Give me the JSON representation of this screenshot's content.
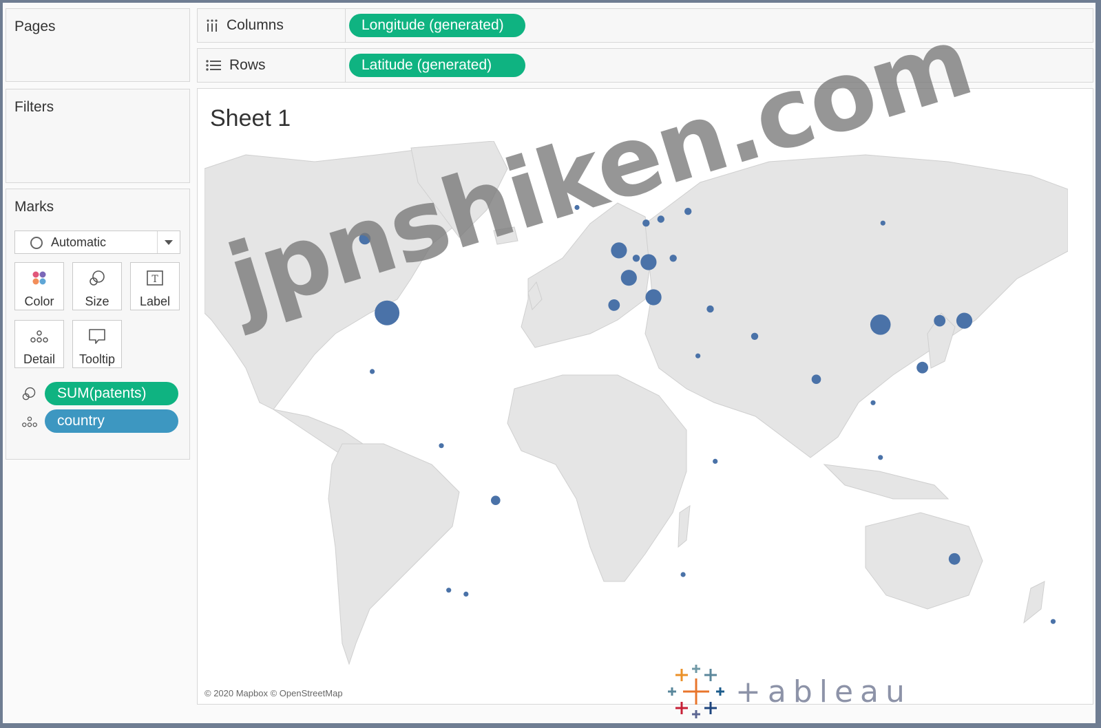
{
  "panels": {
    "pages": {
      "title": "Pages"
    },
    "filters": {
      "title": "Filters"
    },
    "marks": {
      "title": "Marks",
      "mark_type": "Automatic",
      "cards": [
        {
          "label": "Color",
          "icon": "color-icon"
        },
        {
          "label": "Size",
          "icon": "size-icon"
        },
        {
          "label": "Label",
          "icon": "label-icon"
        },
        {
          "label": "Detail",
          "icon": "detail-icon"
        },
        {
          "label": "Tooltip",
          "icon": "tooltip-icon"
        }
      ],
      "fields": [
        {
          "label": "SUM(patents)",
          "icon": "size-icon",
          "color": "#0fb381"
        },
        {
          "label": "country",
          "icon": "detail-icon",
          "color": "#3d97c1"
        }
      ]
    }
  },
  "shelves": {
    "columns": {
      "label": "Columns",
      "pill": "Longitude (generated)"
    },
    "rows": {
      "label": "Rows",
      "pill": "Latitude (generated)"
    }
  },
  "sheet": {
    "title": "Sheet 1",
    "attribution": "© 2020 Mapbox © OpenStreetMap"
  },
  "watermark": "jpnshiken.com",
  "logo": {
    "text": "+ableau"
  },
  "colors": {
    "green_pill": "#0fb381",
    "blue_pill": "#3d97c1",
    "mark": "#4a72a8",
    "land": "#e5e5e5"
  },
  "chart_data": {
    "type": "scatter",
    "description_type": "symbol map",
    "x_field": "Longitude (generated)",
    "y_field": "Latitude (generated)",
    "size_field": "SUM(patents)",
    "detail_field": "country",
    "points": [
      {
        "lon": -96,
        "lat": 38,
        "size": 10
      },
      {
        "lon": -105,
        "lat": 57,
        "size": 4
      },
      {
        "lon": 104,
        "lat": 35,
        "size": 8
      },
      {
        "lon": 138,
        "lat": 36,
        "size": 6
      },
      {
        "lon": 2,
        "lat": 47,
        "size": 6
      },
      {
        "lon": 10,
        "lat": 51,
        "size": 6
      },
      {
        "lon": -2,
        "lat": 54,
        "size": 6
      },
      {
        "lon": 12,
        "lat": 42,
        "size": 6
      },
      {
        "lon": -4,
        "lat": 40,
        "size": 4
      },
      {
        "lon": 128,
        "lat": 36,
        "size": 4
      },
      {
        "lon": 121,
        "lat": 24,
        "size": 4
      },
      {
        "lon": -52,
        "lat": -10,
        "size": 3
      },
      {
        "lon": 134,
        "lat": -25,
        "size": 4
      },
      {
        "lon": 78,
        "lat": 21,
        "size": 3
      },
      {
        "lon": 26,
        "lat": 64,
        "size": 2
      },
      {
        "lon": 15,
        "lat": 62,
        "size": 2
      },
      {
        "lon": 9,
        "lat": 61,
        "size": 2
      },
      {
        "lon": 35,
        "lat": 39,
        "size": 2
      },
      {
        "lon": 53,
        "lat": 32,
        "size": 2
      },
      {
        "lon": 20,
        "lat": 52,
        "size": 2
      },
      {
        "lon": 5,
        "lat": 52,
        "size": 2
      },
      {
        "lon": 24,
        "lat": -29,
        "size": 1
      },
      {
        "lon": 174,
        "lat": -41,
        "size": 1
      },
      {
        "lon": -102,
        "lat": 23,
        "size": 1
      },
      {
        "lon": -64,
        "lat": -34,
        "size": 1
      },
      {
        "lon": -71,
        "lat": -33,
        "size": 1
      },
      {
        "lon": -74,
        "lat": 4,
        "size": 1
      },
      {
        "lon": 30,
        "lat": 27,
        "size": 1
      },
      {
        "lon": 101,
        "lat": 15,
        "size": 1
      },
      {
        "lon": 104,
        "lat": 1,
        "size": 1
      },
      {
        "lon": 37,
        "lat": 0,
        "size": 1
      },
      {
        "lon": -19,
        "lat": 65,
        "size": 1
      },
      {
        "lon": 105,
        "lat": 61,
        "size": 1
      }
    ]
  }
}
